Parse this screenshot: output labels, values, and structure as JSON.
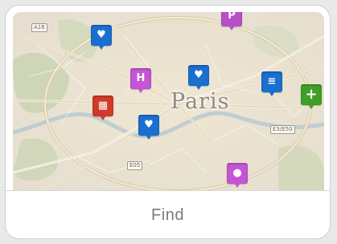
{
  "card": {
    "map": {
      "city_label": "Paris",
      "road_signs": [
        "A16",
        "E05",
        "E3/E50"
      ],
      "markers": [
        {
          "type": "dentist",
          "icon": "tooth-icon",
          "color": "#1a6fd1"
        },
        {
          "type": "parking",
          "icon": "parking-icon",
          "color": "#b84fc8"
        },
        {
          "type": "hospital",
          "icon": "h-icon",
          "color": "#c456d6"
        },
        {
          "type": "dentist",
          "icon": "tooth-icon",
          "color": "#1a6fd1"
        },
        {
          "type": "medical-service",
          "icon": "stretcher-icon",
          "color": "#1a6fd1"
        },
        {
          "type": "pharmacy",
          "icon": "plus-icon",
          "color": "#3f9f27"
        },
        {
          "type": "emergency",
          "icon": "ambulance-icon",
          "color": "#d13a2a"
        },
        {
          "type": "dentist",
          "icon": "tooth-icon",
          "color": "#1a6fd1"
        },
        {
          "type": "service",
          "icon": "pin-icon",
          "color": "#c456d6"
        }
      ]
    },
    "find_label": "Find"
  }
}
